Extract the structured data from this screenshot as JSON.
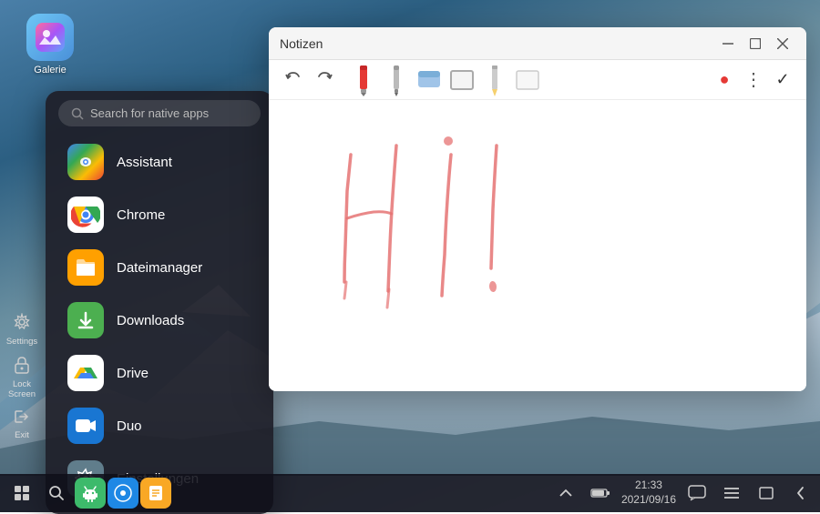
{
  "desktop": {
    "background_desc": "mountain landscape"
  },
  "gallery_icon": {
    "label": "Galerie",
    "emoji": "🖼️"
  },
  "app_drawer": {
    "search_placeholder": "Search for native apps",
    "apps": [
      {
        "id": "assistant",
        "label": "Assistant",
        "color": "#4285F4",
        "emoji": "🎙️"
      },
      {
        "id": "chrome",
        "label": "Chrome",
        "color": "#fff",
        "emoji": "🌐"
      },
      {
        "id": "dateimanager",
        "label": "Dateimanager",
        "color": "#FFA000",
        "emoji": "📁"
      },
      {
        "id": "downloads",
        "label": "Downloads",
        "color": "#4CAF50",
        "emoji": "⬇️"
      },
      {
        "id": "drive",
        "label": "Drive",
        "color": "#fff",
        "emoji": "△"
      },
      {
        "id": "duo",
        "label": "Duo",
        "color": "#1976D2",
        "emoji": "📹"
      },
      {
        "id": "einstellungen",
        "label": "Einstellungen",
        "color": "#888",
        "emoji": "⚙️"
      }
    ]
  },
  "notizen_window": {
    "title": "Notizen",
    "minimize_label": "−",
    "maximize_label": "⤢",
    "close_label": "✕",
    "toolbar": {
      "undo_label": "←",
      "redo_label": "→",
      "record_label": "●",
      "more_label": "⋮",
      "check_label": "✓"
    }
  },
  "left_sidebar": {
    "items": [
      {
        "id": "settings",
        "label": "Settings",
        "icon": "⚙️"
      },
      {
        "id": "lock-screen",
        "label": "Lock Screen",
        "icon": "🔒"
      },
      {
        "id": "exit",
        "label": "Exit",
        "icon": "⇥"
      }
    ]
  },
  "taskbar": {
    "time": "21:33",
    "date": "2021/09/16",
    "icons": [
      {
        "id": "grid",
        "emoji": "⊞"
      },
      {
        "id": "search",
        "emoji": "🔍"
      },
      {
        "id": "android",
        "emoji": "🤖"
      },
      {
        "id": "launcher",
        "emoji": "⊙"
      },
      {
        "id": "notes-app",
        "emoji": "📝"
      }
    ],
    "sys_icons": [
      {
        "id": "chevron-up",
        "emoji": "∧"
      },
      {
        "id": "battery",
        "emoji": "🔋"
      },
      {
        "id": "chat",
        "emoji": "💬"
      },
      {
        "id": "menu",
        "emoji": "≡"
      },
      {
        "id": "window",
        "emoji": "▭"
      },
      {
        "id": "back",
        "emoji": "◁"
      }
    ]
  }
}
